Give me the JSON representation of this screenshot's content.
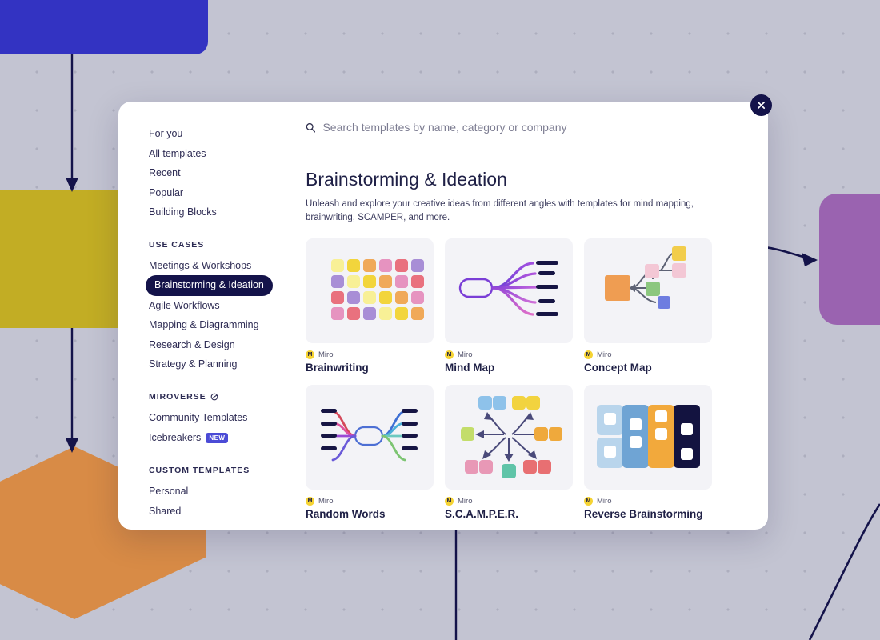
{
  "canvas": {
    "shapes": [
      {
        "name": "blue-rounded-rect",
        "color": "#3333c2"
      },
      {
        "name": "yellow-rect",
        "color": "#c2ad24"
      },
      {
        "name": "orange-hexagon",
        "color": "#d88b46"
      },
      {
        "name": "purple-rounded-rect",
        "color": "#9a63b0"
      }
    ],
    "connector_color": "#14134a",
    "dot_color": "#adaebe",
    "background": "#c3c4d2"
  },
  "modal": {
    "close_label": "×",
    "search": {
      "icon": "search-icon",
      "placeholder": "Search templates by name, category or company",
      "value": ""
    },
    "sidebar": {
      "primary": [
        {
          "label": "For you"
        },
        {
          "label": "All templates"
        },
        {
          "label": "Recent"
        },
        {
          "label": "Popular"
        },
        {
          "label": "Building Blocks"
        }
      ],
      "use_cases_heading": "USE CASES",
      "use_cases": [
        {
          "label": "Meetings & Workshops",
          "selected": false
        },
        {
          "label": "Brainstorming & Ideation",
          "selected": true
        },
        {
          "label": "Agile Workflows",
          "selected": false
        },
        {
          "label": "Mapping & Diagramming",
          "selected": false
        },
        {
          "label": "Research & Design",
          "selected": false
        },
        {
          "label": "Strategy & Planning",
          "selected": false
        }
      ],
      "miroverse_heading": "MIROVERSE",
      "miroverse": [
        {
          "label": "Community Templates",
          "badge": ""
        },
        {
          "label": "Icebreakers",
          "badge": "NEW"
        }
      ],
      "custom_heading": "CUSTOM TEMPLATES",
      "custom": [
        {
          "label": "Personal"
        },
        {
          "label": "Shared"
        }
      ],
      "selected_pill_color": "#14134a",
      "badge_color": "#4b4bd6"
    },
    "content": {
      "title": "Brainstorming & Ideation",
      "description": "Unleash and explore your creative ideas from different angles with templates for mind mapping, brainwriting, SCAMPER, and more.",
      "cards": [
        {
          "id": "brainwriting",
          "author": "Miro",
          "title": "Brainwriting"
        },
        {
          "id": "mind-map",
          "author": "Miro",
          "title": "Mind Map"
        },
        {
          "id": "concept-map",
          "author": "Miro",
          "title": "Concept Map"
        },
        {
          "id": "random-words",
          "author": "Miro",
          "title": "Random Words"
        },
        {
          "id": "scamper",
          "author": "Miro",
          "title": "S.C.A.M.P.E.R."
        },
        {
          "id": "reverse-brainstorming",
          "author": "Miro",
          "title": "Reverse Brainstorming"
        }
      ]
    }
  }
}
